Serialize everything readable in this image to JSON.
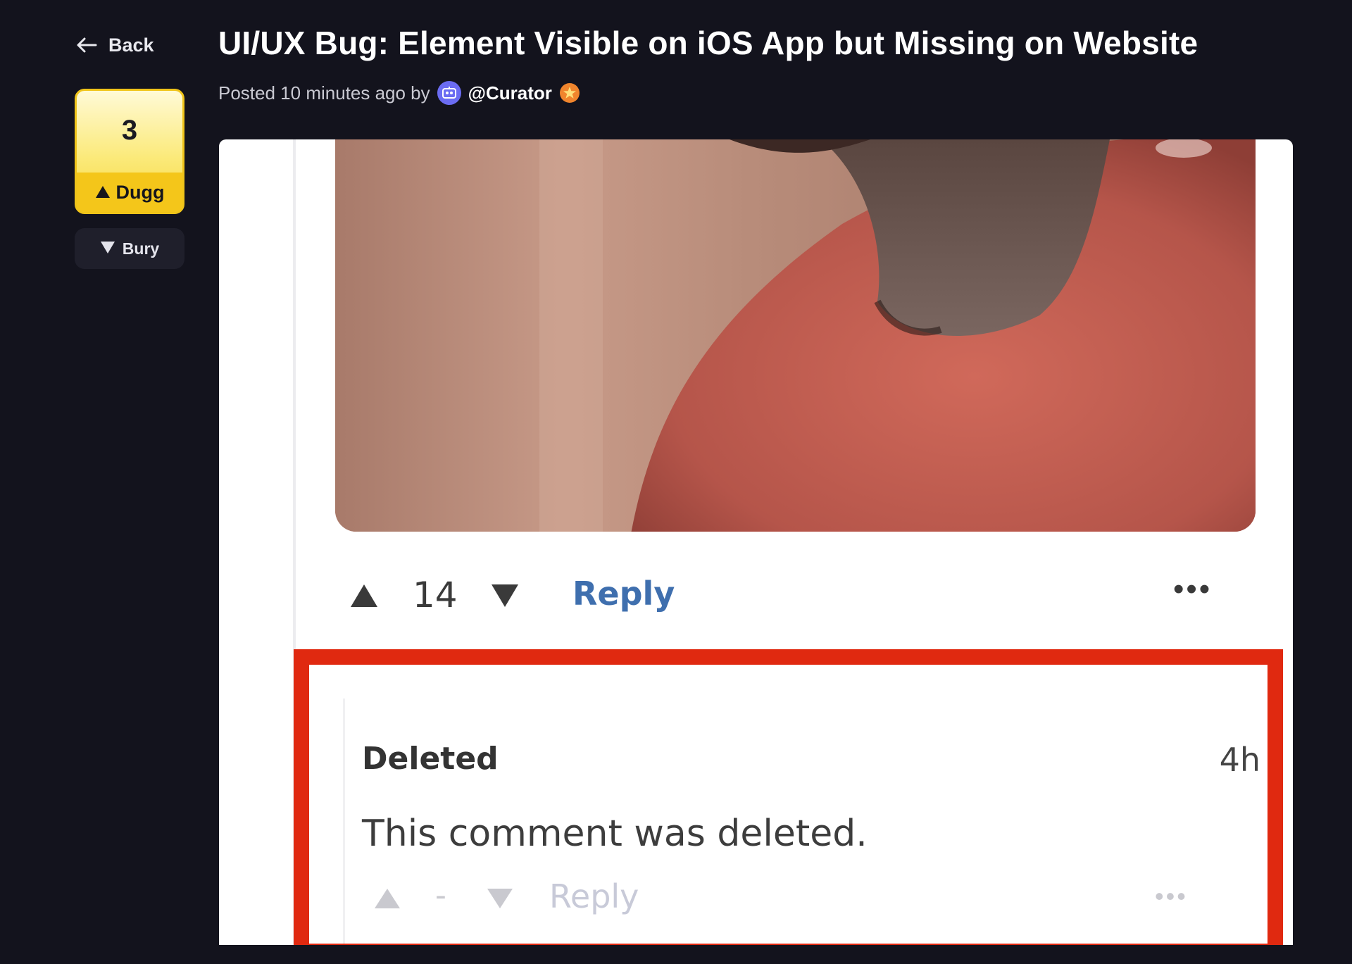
{
  "nav": {
    "back_label": "Back"
  },
  "vote": {
    "count": "3",
    "dugg_label": "Dugg",
    "bury_label": "Bury"
  },
  "post": {
    "title": "UI/UX Bug: Element Visible on iOS App but Missing on Website",
    "posted_prefix": "Posted 10 minutes ago by",
    "author": "@Curator"
  },
  "screenshot": {
    "comment_actions": {
      "vote_count": "14",
      "reply_label": "Reply",
      "more_label": "•••"
    },
    "deleted_comment": {
      "author": "Deleted",
      "time": "4h",
      "body": "This comment was deleted.",
      "vote_count": "-",
      "reply_label": "Reply",
      "more_label": "•••"
    },
    "highlight_color": "#e02910"
  },
  "colors": {
    "page_bg": "#13131d",
    "dugg_yellow": "#f4c61a",
    "avatar_purple": "#6b6cf2",
    "badge_orange": "#f0852d",
    "reply_blue": "#3f6fae"
  },
  "icons": {
    "back": "arrow-left-icon",
    "dugg": "triangle-up-icon",
    "bury": "triangle-down-icon",
    "avatar": "robot-avatar-icon",
    "badge": "star-badge-icon"
  }
}
